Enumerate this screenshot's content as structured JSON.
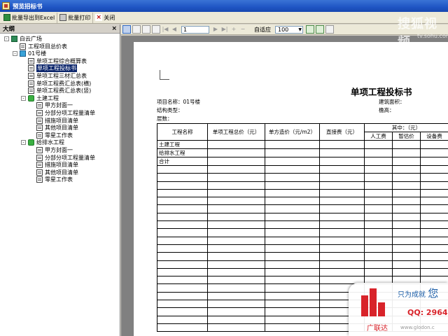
{
  "window": {
    "title": "预览招标书"
  },
  "toolbar": {
    "export_label": "批量导出到Excel",
    "print_label": "批量打印",
    "close_label": "关闭"
  },
  "outline": {
    "title": "大纲",
    "close": "×",
    "items": [
      {
        "label": "白云广场",
        "level": 0,
        "icon": "site-icon",
        "expander": "-"
      },
      {
        "label": "工程项目总价表",
        "level": 1,
        "icon": "document-icon"
      },
      {
        "label": "01号楼",
        "level": 1,
        "icon": "building-icon",
        "expander": "-"
      },
      {
        "label": "单项工程综合概算表",
        "level": 2,
        "icon": "document-icon"
      },
      {
        "label": "单项工程投标书",
        "level": 2,
        "icon": "document-icon",
        "selected": true
      },
      {
        "label": "单项工程三材汇总表",
        "level": 2,
        "icon": "document-icon"
      },
      {
        "label": "单项工程费汇总表(横)",
        "level": 2,
        "icon": "document-icon"
      },
      {
        "label": "单项工程费汇总表(竖)",
        "level": 2,
        "icon": "document-icon"
      },
      {
        "label": "土建工程",
        "level": 2,
        "icon": "group-icon",
        "expander": "-"
      },
      {
        "label": "甲方封面一",
        "level": 3,
        "icon": "document-icon"
      },
      {
        "label": "分部分项工程量清单",
        "level": 3,
        "icon": "document-icon"
      },
      {
        "label": "措施项目清单",
        "level": 3,
        "icon": "document-icon"
      },
      {
        "label": "其他项目清单",
        "level": 3,
        "icon": "document-icon"
      },
      {
        "label": "零星工作表",
        "level": 3,
        "icon": "document-icon"
      },
      {
        "label": "给排水工程",
        "level": 2,
        "icon": "group-icon",
        "expander": "-"
      },
      {
        "label": "甲方封面一",
        "level": 3,
        "icon": "document-icon"
      },
      {
        "label": "分部分项工程量清单",
        "level": 3,
        "icon": "document-icon"
      },
      {
        "label": "措施项目清单",
        "level": 3,
        "icon": "document-icon"
      },
      {
        "label": "其他项目清单",
        "level": 3,
        "icon": "document-icon"
      },
      {
        "label": "零星工作表",
        "level": 3,
        "icon": "document-icon"
      }
    ]
  },
  "preview_toolbar": {
    "page": "1",
    "fit_label": "自适应",
    "zoom": "100"
  },
  "report": {
    "title": "单项工程投标书",
    "project_name_label": "项目名称：01号楼",
    "structure_label": "结构类型：",
    "floors_label": "层数：",
    "area_label": "建筑面积：",
    "height_label": "檐高：",
    "columns": {
      "name": "工程名称",
      "total": "单项工程总价（元）",
      "unit_cost": "单方造价（元/m2）",
      "direct": "直接费（元）",
      "of_which": "其中：（元）",
      "labor": "人工费",
      "material": "暂估价",
      "equipment": "设备费"
    },
    "rows": [
      "土建工程",
      "给排水工程",
      "合计"
    ]
  },
  "watermark": {
    "brand": "搜狐视频",
    "url": "tv.sohu.com"
  },
  "ad": {
    "slogan_small": "只为成就",
    "slogan_big": "您",
    "qq": "QQ: 2964",
    "brand": "广联达",
    "url": "www.glodon.c"
  }
}
